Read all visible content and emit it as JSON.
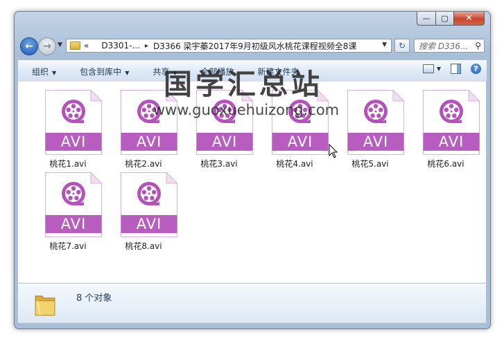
{
  "window": {
    "caption": {
      "minimize": "—",
      "maximize": "▢",
      "close": "✕"
    }
  },
  "nav": {
    "back_icon": "back-arrow-icon",
    "forward_icon": "forward-arrow-icon",
    "address": {
      "overflow": "«",
      "crumbs": [
        "D3301-...",
        "D3366 梁宇蓁2017年9月初级风水桃花课程视频全8课"
      ],
      "separator": "▸"
    },
    "search": {
      "placeholder": "搜索 D336..."
    }
  },
  "toolbar": {
    "items": [
      {
        "label": "组织",
        "has_dropdown": true
      },
      {
        "label": "包含到库中",
        "has_dropdown": true
      },
      {
        "label": "共享",
        "has_dropdown": true
      },
      {
        "label": "全部播放",
        "has_dropdown": false
      },
      {
        "label": "新建文件夹",
        "has_dropdown": false
      }
    ],
    "dropdown_arrow": "▼"
  },
  "files": {
    "type_label": "AVI",
    "items": [
      {
        "name": "桃花1.avi"
      },
      {
        "name": "桃花2.avi"
      },
      {
        "name": "桃花3.avi"
      },
      {
        "name": "桃花4.avi"
      },
      {
        "name": "桃花5.avi"
      },
      {
        "name": "桃花6.avi"
      },
      {
        "name": "桃花7.avi"
      },
      {
        "name": "桃花8.avi"
      }
    ]
  },
  "watermark": {
    "title": "国学汇总站",
    "url": "www.guoxuehuizong.com"
  },
  "details": {
    "status": "8 个对象"
  },
  "colors": {
    "avi_band": "#b65dbf",
    "icon_purple": "#b352b9",
    "doc_border": "#d7b1dc"
  }
}
